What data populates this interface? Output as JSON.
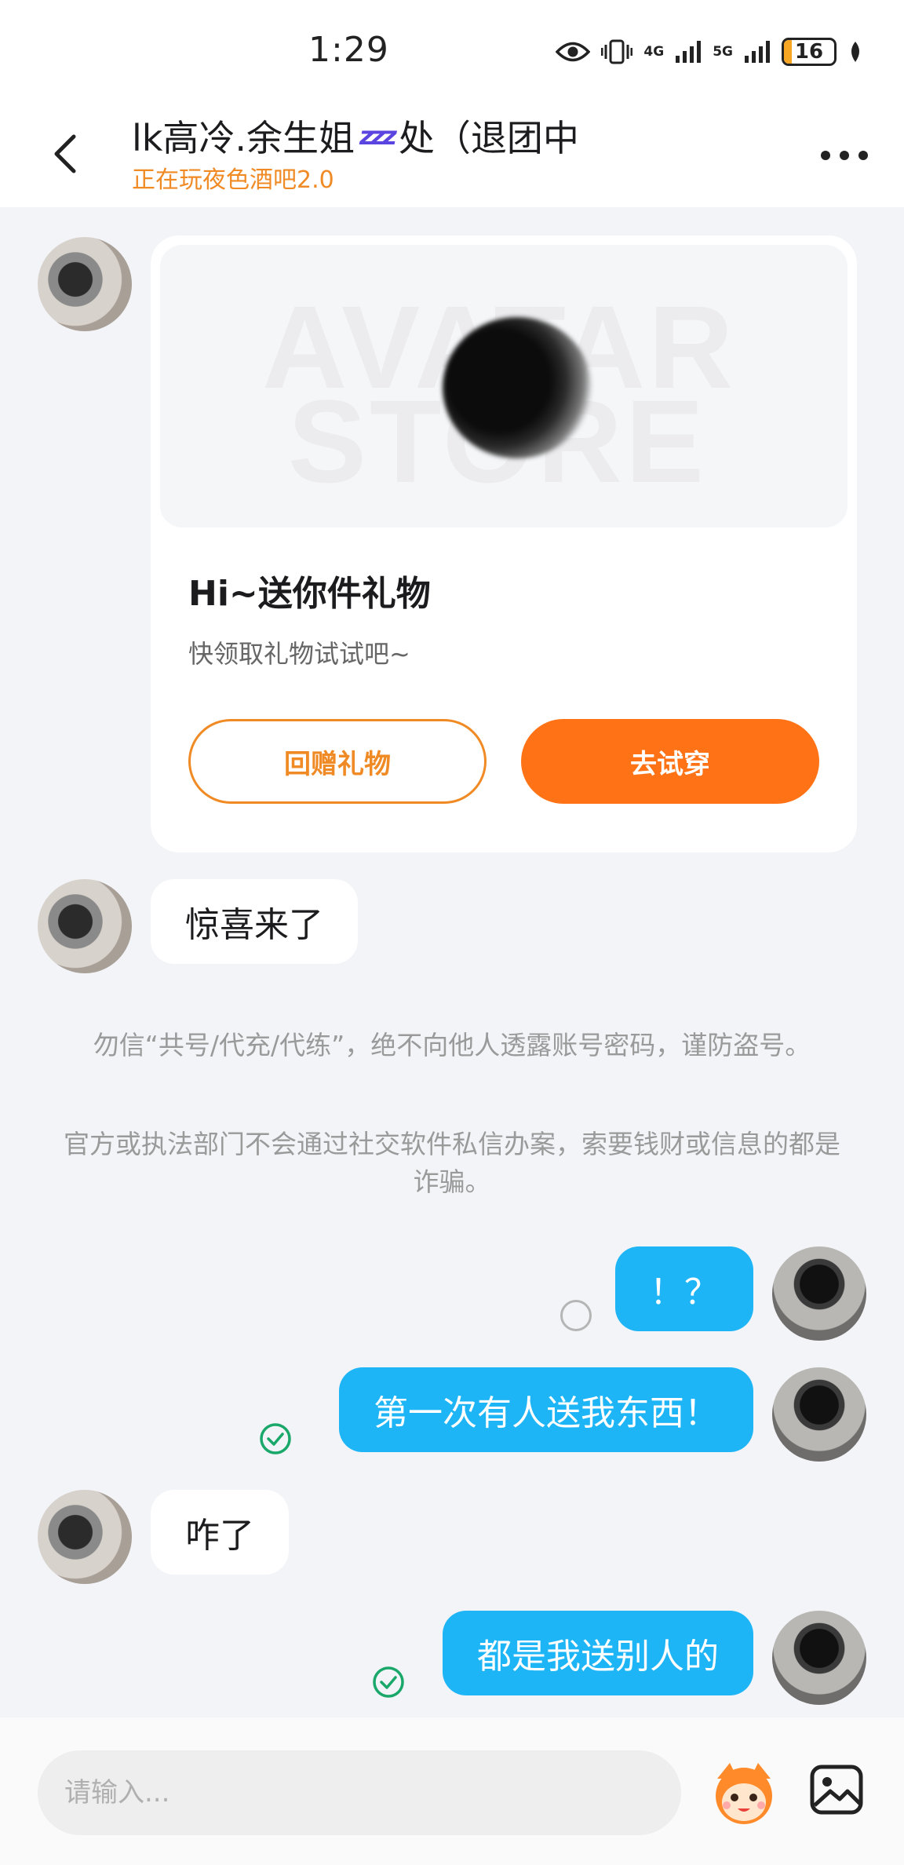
{
  "status_bar": {
    "time": "1:29",
    "network_1": "4G",
    "network_2": "5G",
    "battery": "16",
    "battery_level": 0.16
  },
  "header": {
    "title_prefix": "lk高冷.余生姐",
    "title_emoji": "zzz",
    "title_suffix": "处（退团中",
    "subtitle": "正在玩夜色酒吧2.0"
  },
  "gift_card": {
    "watermark": "AVATAR STORE",
    "title": "Hi~送你件礼物",
    "description": "快领取礼物试试吧~",
    "return_button": "回赠礼物",
    "try_button": "去试穿"
  },
  "messages": {
    "m1": "惊喜来了",
    "m2": "！？",
    "m3": "第一次有人送我东西！",
    "m4": "咋了",
    "m5": "都是我送别人的"
  },
  "notices": {
    "n1": "勿信“共号/代充/代练”，绝不向他人透露账号密码，谨防盗号。",
    "n2": "官方或执法部门不会通过社交软件私信办案，索要钱财或信息的都是诈骗。"
  },
  "input": {
    "placeholder": "请输入..."
  },
  "icons": {
    "eye": "eye-icon",
    "vibrate": "vibrate-icon",
    "signal": "signal-icon",
    "leaf": "leaf-icon",
    "back": "back-arrow-icon",
    "more": "more-icon",
    "check": "check-circle-icon",
    "emoji": "emoji-mascot-icon",
    "image": "image-icon"
  },
  "colors": {
    "accent_orange": "#ff7316",
    "subtitle_orange": "#f08a24",
    "my_bubble": "#1eb5f7",
    "check_green": "#1aa86a"
  }
}
